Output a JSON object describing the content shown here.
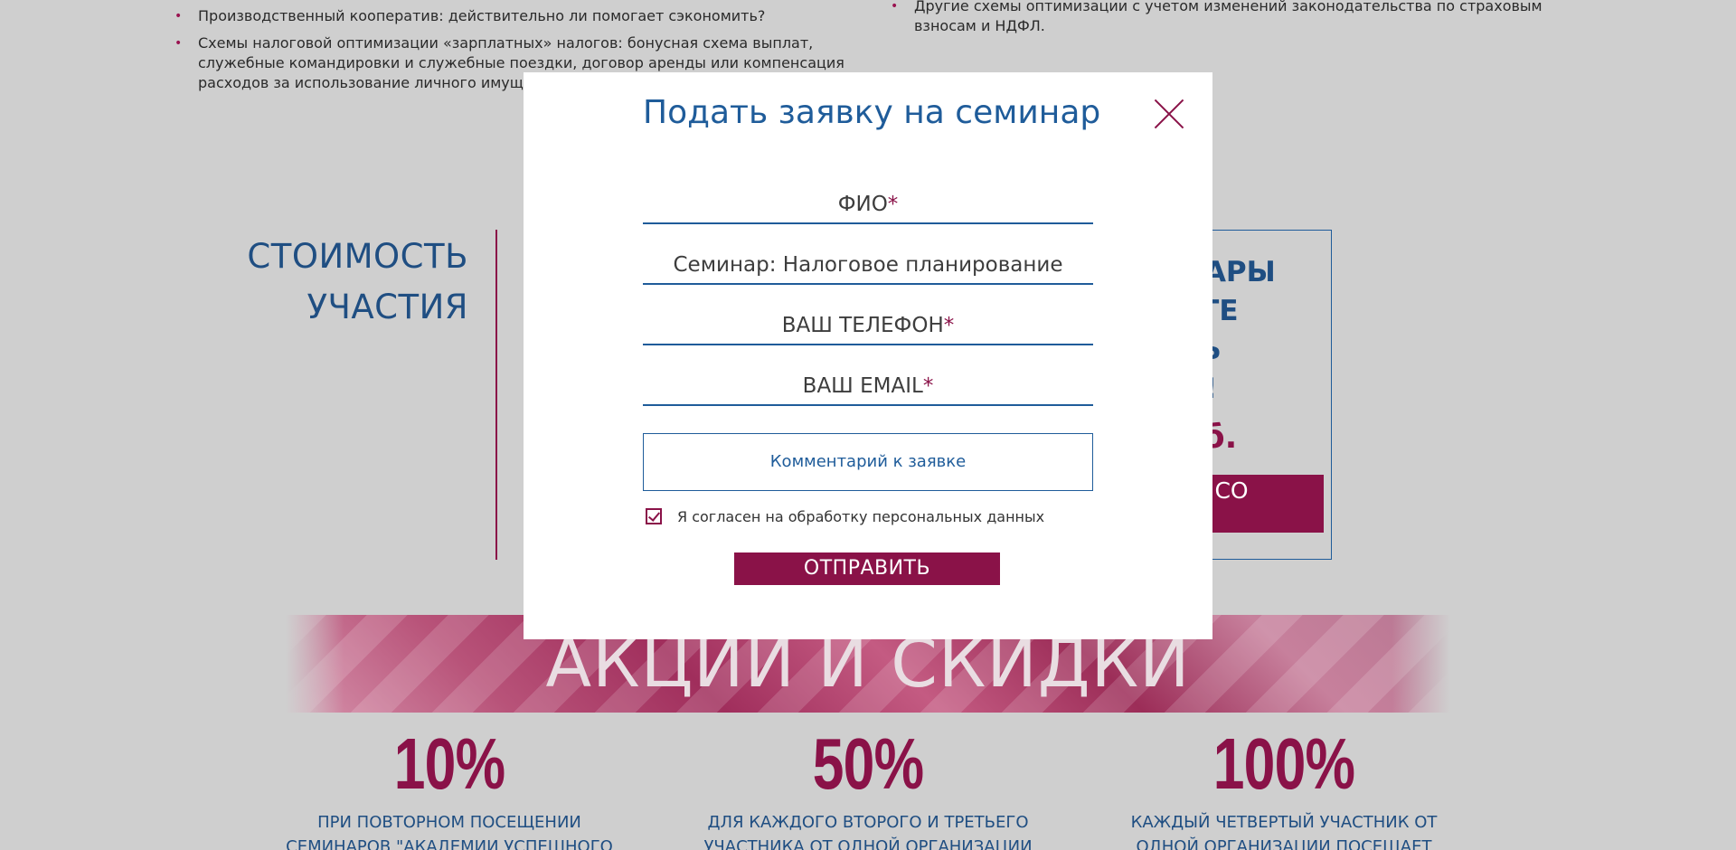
{
  "background": {
    "bullets_left": [
      "Производственный кооператив: действительно ли помогает сэкономить?",
      "Схемы налоговой оптимизации «зарплатных» налогов: бонусная схема выплат, служебные командировки и служебные поездки, договор аренды или компенсация расходов за использование личного имущества работника"
    ],
    "bullets_right": [
      "Другие схемы оптимизации с учетом изменений законодательства по страховым взносам и НДФЛ."
    ],
    "cost_title_line1": "СТОИМОСТЬ",
    "cost_title_line2": "УЧАСТИЯ",
    "right_box": {
      "headline_line1": "НАРЫ",
      "headline_line2": "ЕТЕ",
      "headline_line3": "ТЬ",
      "headline_line4": "Н!",
      "price": "уб.",
      "pay_line1": "АТЬ СО",
      "pay_line2": "Й"
    },
    "promo_title": "АКЦИИ И СКИДКИ",
    "discounts": [
      {
        "percent": "10%",
        "line1": "ПРИ ПОВТОРНОМ ПОСЕЩЕНИИ",
        "line2": "СЕМИНАРОВ \"АКАДЕМИИ УСПЕШНОГО"
      },
      {
        "percent": "50%",
        "line1": "ДЛЯ КАЖДОГО ВТОРОГО И ТРЕТЬЕГО",
        "line2": "УЧАСТНИКА ОТ ОДНОЙ ОРГАНИЗАЦИИ"
      },
      {
        "percent": "100%",
        "line1": "КАЖДЫЙ ЧЕТВЕРТЫЙ УЧАСТНИК ОТ",
        "line2": "ОДНОЙ ОРГАНИЗАЦИИ ПОСЕЩАЕТ"
      }
    ]
  },
  "modal": {
    "title": "Подать заявку на семинар",
    "fields": {
      "name": {
        "label": "ФИО",
        "required_mark": "*"
      },
      "seminar": {
        "value": "Семинар: Налоговое планирование"
      },
      "phone": {
        "label": "ВАШ ТЕЛЕФОН",
        "required_mark": "*"
      },
      "email": {
        "label": "ВАШ EMAIL",
        "required_mark": "*"
      }
    },
    "comment_placeholder": "Комментарий к заявке",
    "consent_text": "Я согласен на обработку персональных данных",
    "consent_checked": true,
    "submit_label": "ОТПРАВИТЬ"
  },
  "colors": {
    "accent": "#8a1248",
    "primary": "#1f5c9a",
    "overlay": "#cfcfcf"
  }
}
